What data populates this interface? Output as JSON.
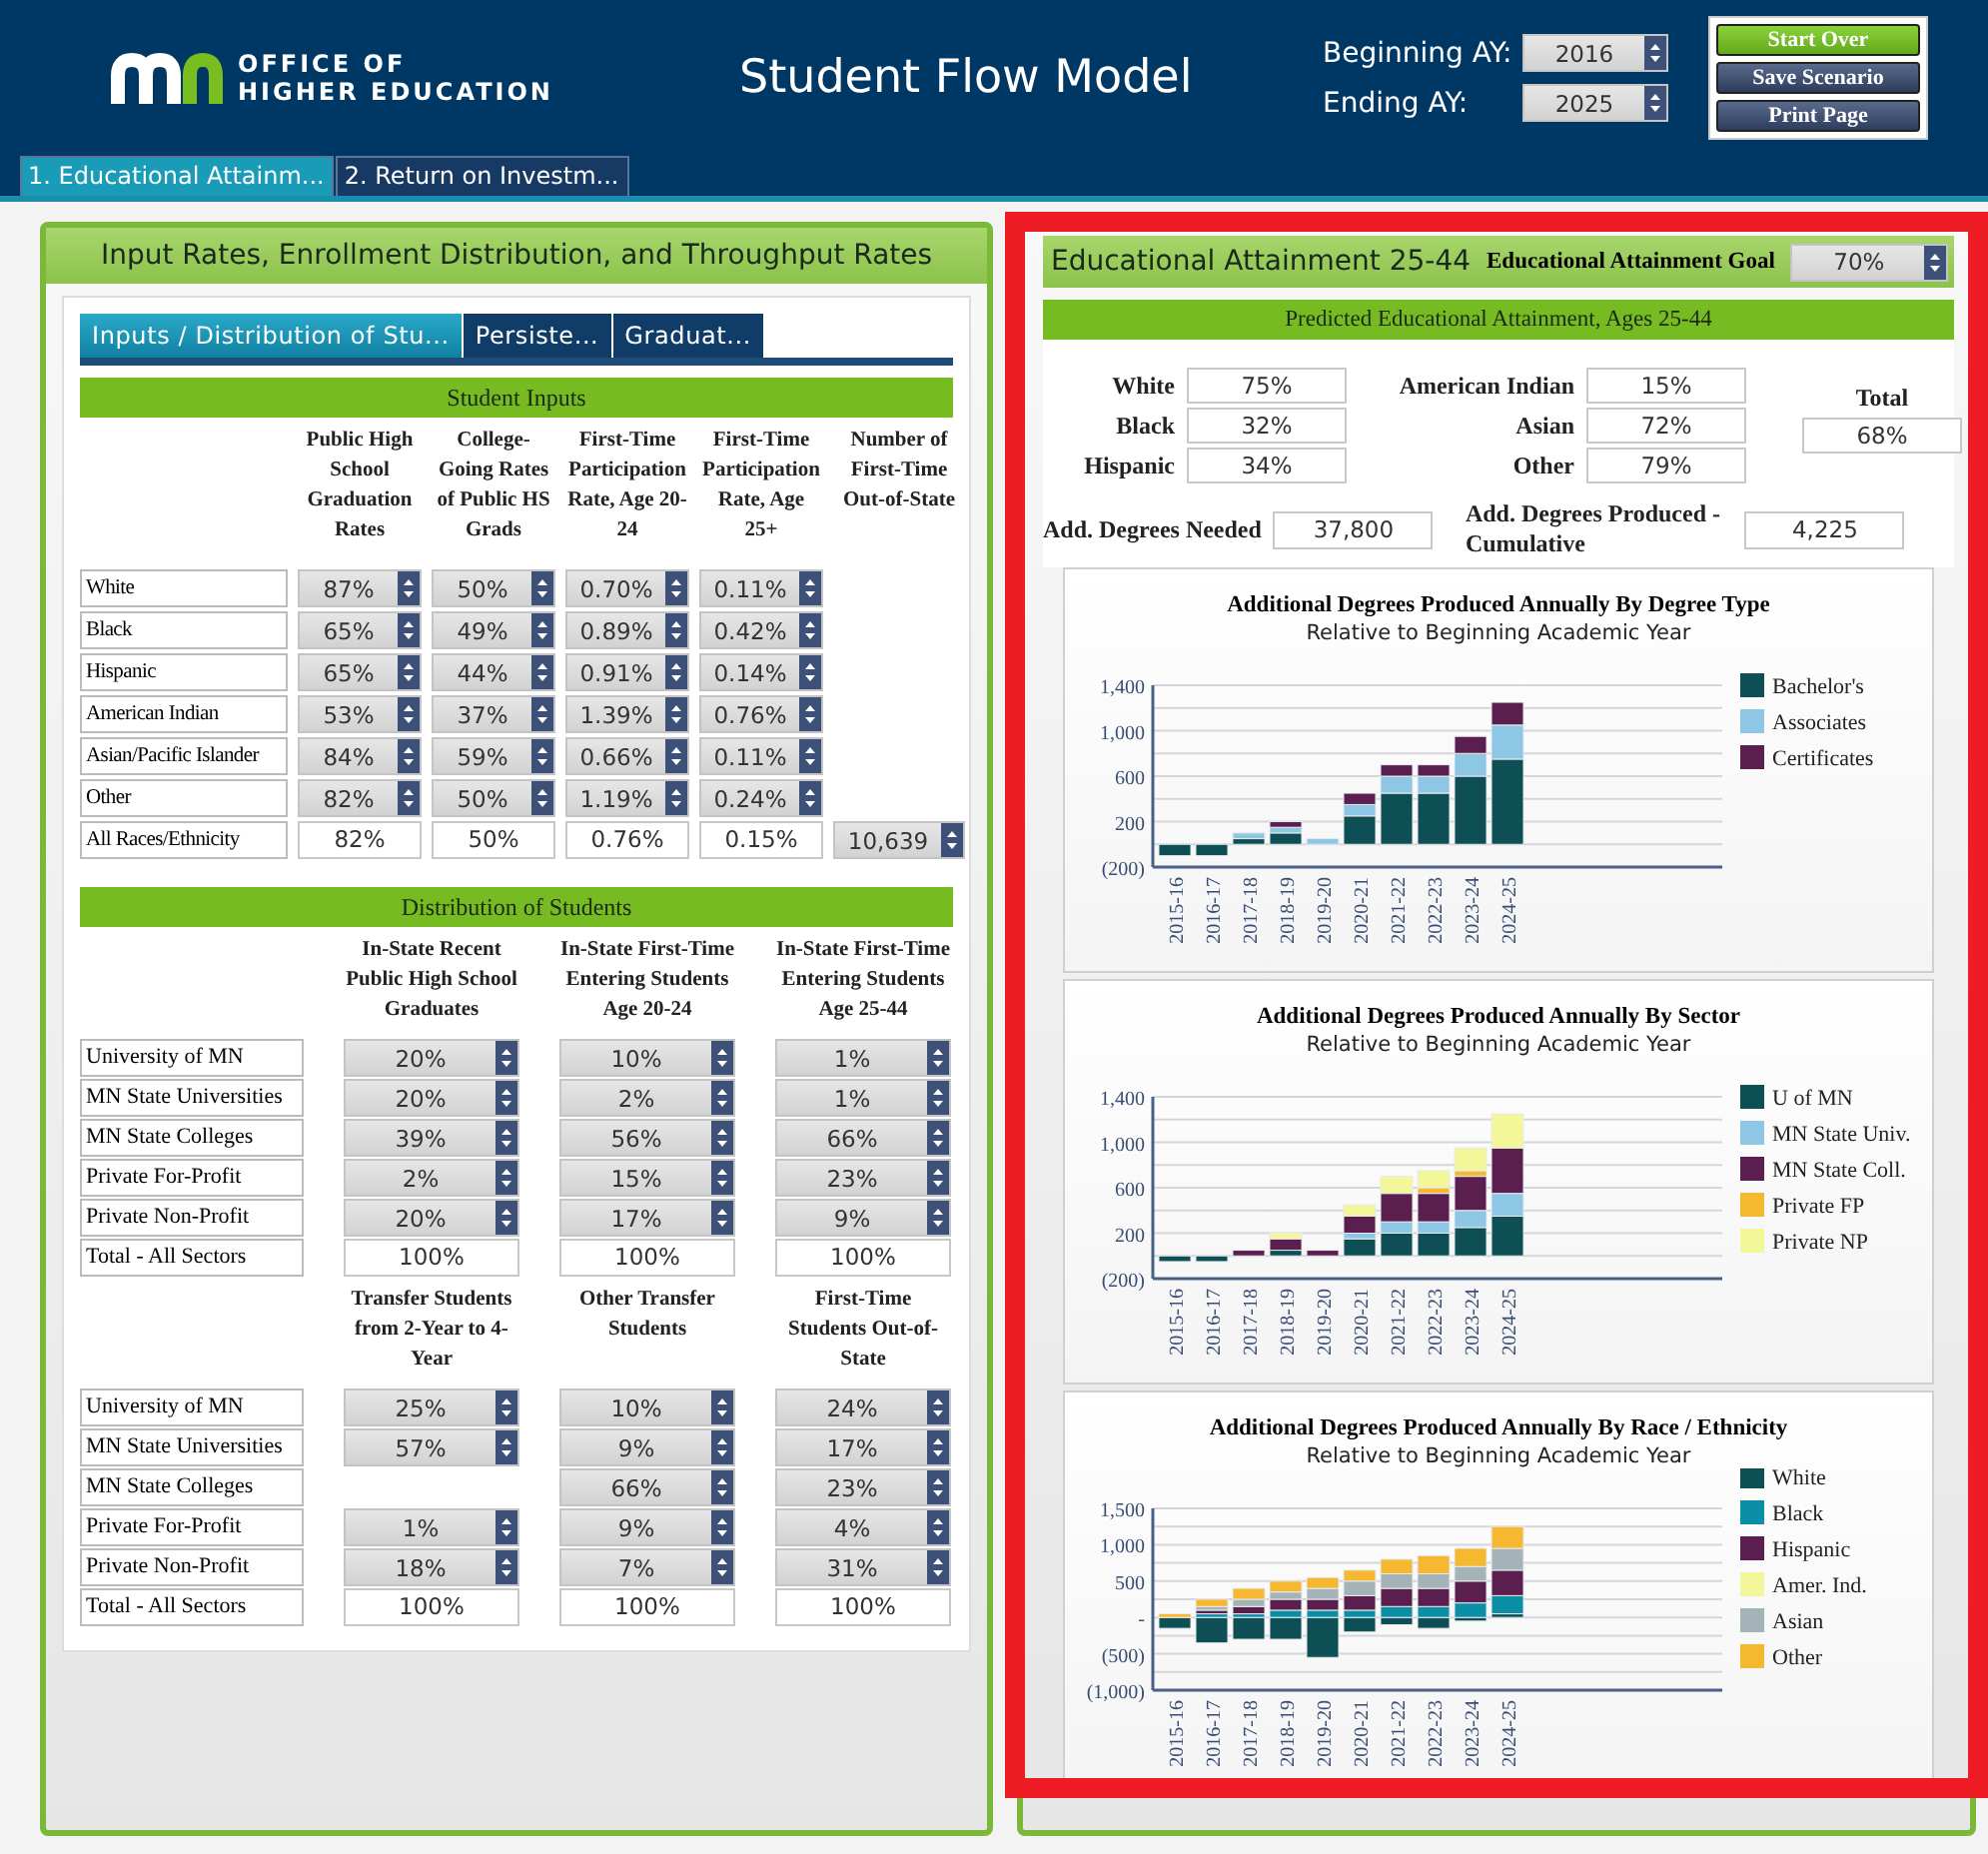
{
  "header": {
    "logo_lines": [
      "OFFICE OF",
      "HIGHER EDUCATION"
    ],
    "title": "Student Flow Model",
    "years": [
      {
        "label": "Beginning AY:",
        "value": "2016"
      },
      {
        "label": "Ending AY:",
        "value": "2025"
      }
    ],
    "buttons": [
      {
        "label": "Start Over",
        "kind": "primary"
      },
      {
        "label": "Save Scenario",
        "kind": "secondary"
      },
      {
        "label": "Print Page",
        "kind": "secondary"
      }
    ]
  },
  "main_tabs": [
    {
      "label": "1. Educational Attainm...",
      "selected": true
    },
    {
      "label": "2. Return on Investm...",
      "selected": false
    }
  ],
  "left_panel": {
    "title": "Input Rates, Enrollment Distribution, and Throughput Rates",
    "tabs": [
      {
        "label": "Inputs / Distribution of Stu...",
        "selected": true
      },
      {
        "label": "Persiste...",
        "selected": false
      },
      {
        "label": "Graduat...",
        "selected": false
      }
    ],
    "student_inputs": {
      "title": "Student Inputs",
      "columns": [
        "Public High School Graduation Rates",
        "College-Going Rates of Public HS Grads",
        "First-Time Participation Rate, Age 20-24",
        "First-Time Participation Rate, Age 25+",
        "Number of First-Time Out-of-State"
      ],
      "rows": [
        {
          "label": "White",
          "values": [
            "87%",
            "50%",
            "0.70%",
            "0.11%"
          ]
        },
        {
          "label": "Black",
          "values": [
            "65%",
            "49%",
            "0.89%",
            "0.42%"
          ]
        },
        {
          "label": "Hispanic",
          "values": [
            "65%",
            "44%",
            "0.91%",
            "0.14%"
          ]
        },
        {
          "label": "American Indian",
          "values": [
            "53%",
            "37%",
            "1.39%",
            "0.76%"
          ]
        },
        {
          "label": "Asian/Pacific Islander",
          "values": [
            "84%",
            "59%",
            "0.66%",
            "0.11%"
          ]
        },
        {
          "label": "Other",
          "values": [
            "82%",
            "50%",
            "1.19%",
            "0.24%"
          ]
        }
      ],
      "total": {
        "label": "All Races/Ethnicity",
        "values": [
          "82%",
          "50%",
          "0.76%",
          "0.15%"
        ],
        "out_of_state": "10,639"
      }
    },
    "distribution": {
      "title": "Distribution of Students",
      "groups": [
        {
          "columns": [
            "In-State Recent Public High School Graduates",
            "In-State First-Time Entering Students Age 20-24",
            "In-State First-Time Entering Students Age 25-44"
          ],
          "rows": [
            {
              "label": "University of MN",
              "values": [
                "20%",
                "10%",
                "1%"
              ]
            },
            {
              "label": "MN State Universities",
              "values": [
                "20%",
                "2%",
                "1%"
              ]
            },
            {
              "label": "MN State Colleges",
              "values": [
                "39%",
                "56%",
                "66%"
              ]
            },
            {
              "label": "Private For-Profit",
              "values": [
                "2%",
                "15%",
                "23%"
              ]
            },
            {
              "label": "Private Non-Profit",
              "values": [
                "20%",
                "17%",
                "9%"
              ]
            }
          ],
          "total": {
            "label": "Total - All Sectors",
            "values": [
              "100%",
              "100%",
              "100%"
            ]
          }
        },
        {
          "columns": [
            "Transfer Students from 2-Year to 4-Year",
            "Other Transfer Students",
            "First-Time Students Out-of-State"
          ],
          "rows": [
            {
              "label": "University of MN",
              "cells": [
                {
                  "kind": "spin",
                  "value": "25%"
                },
                {
                  "kind": "spin",
                  "value": "10%"
                },
                {
                  "kind": "spin",
                  "value": "24%"
                }
              ]
            },
            {
              "label": "MN State Universities",
              "cells": [
                {
                  "kind": "spin",
                  "value": "57%"
                },
                {
                  "kind": "spin",
                  "value": "9%"
                },
                {
                  "kind": "spin",
                  "value": "17%"
                }
              ]
            },
            {
              "label": "MN State Colleges",
              "cells": [
                {
                  "kind": "blank"
                },
                {
                  "kind": "spin",
                  "value": "66%"
                },
                {
                  "kind": "spin",
                  "value": "23%"
                }
              ]
            },
            {
              "label": "Private For-Profit",
              "cells": [
                {
                  "kind": "spin",
                  "value": "1%"
                },
                {
                  "kind": "spin",
                  "value": "9%"
                },
                {
                  "kind": "spin",
                  "value": "4%"
                }
              ]
            },
            {
              "label": "Private Non-Profit",
              "cells": [
                {
                  "kind": "spin",
                  "value": "18%"
                },
                {
                  "kind": "spin",
                  "value": "7%"
                },
                {
                  "kind": "spin",
                  "value": "31%"
                }
              ]
            }
          ],
          "total": {
            "label": "Total - All Sectors",
            "values": [
              "100%",
              "100%",
              "100%"
            ]
          }
        }
      ]
    }
  },
  "right_panel": {
    "title": "Educational Attainment 25-44",
    "goal": {
      "label": "Educational Attainment Goal",
      "value": "70%"
    },
    "subtitle": "Predicted Educational Attainment, Ages 25-44",
    "attainment": [
      {
        "label": "White",
        "value": "75%"
      },
      {
        "label": "Black",
        "value": "32%"
      },
      {
        "label": "Hispanic",
        "value": "34%"
      },
      {
        "label": "American Indian",
        "value": "15%"
      },
      {
        "label": "Asian",
        "value": "72%"
      },
      {
        "label": "Other",
        "value": "79%"
      }
    ],
    "total": {
      "label": "Total",
      "value": "68%"
    },
    "needed": {
      "label": "Add. Degrees Needed",
      "value": "37,800"
    },
    "produced": {
      "label": "Add. Degrees Produced - Cumulative",
      "value": "4,225"
    },
    "charts": [
      {
        "subtitle": "Relative to Beginning Academic Year",
        "chart_data": {
          "type": "bar",
          "title": "Additional Degrees Produced Annually By Degree Type",
          "stacked": true,
          "grid": true,
          "legend": true,
          "categories": [
            "2015-16",
            "2016-17",
            "2017-18",
            "2018-19",
            "2019-20",
            "2020-21",
            "2021-22",
            "2022-23",
            "2023-24",
            "2024-25"
          ],
          "ylim": [
            -200,
            1400
          ],
          "yticks": [
            {
              "value": -200,
              "label": "(200)"
            },
            {
              "value": 200,
              "label": "200"
            },
            {
              "value": 600,
              "label": "600"
            },
            {
              "value": 1000,
              "label": "1,000"
            },
            {
              "value": 1400,
              "label": "1,400"
            }
          ],
          "series": [
            {
              "name": "Bachelor's",
              "color": "#0d4f55",
              "values": [
                -100,
                -100,
                50,
                100,
                0,
                250,
                450,
                450,
                600,
                750
              ]
            },
            {
              "name": "Associates",
              "color": "#8ec6e6",
              "values": [
                0,
                0,
                50,
                50,
                50,
                100,
                150,
                150,
                200,
                300
              ]
            },
            {
              "name": "Certificates",
              "color": "#5a1f4f",
              "values": [
                0,
                0,
                0,
                50,
                0,
                100,
                100,
                100,
                150,
                200
              ]
            }
          ]
        }
      },
      {
        "subtitle": "Relative to Beginning Academic Year",
        "chart_data": {
          "type": "bar",
          "title": "Additional Degrees Produced Annually By Sector",
          "stacked": true,
          "grid": true,
          "legend": true,
          "categories": [
            "2015-16",
            "2016-17",
            "2017-18",
            "2018-19",
            "2019-20",
            "2020-21",
            "2021-22",
            "2022-23",
            "2023-24",
            "2024-25"
          ],
          "ylim": [
            -200,
            1400
          ],
          "yticks": [
            {
              "value": -200,
              "label": "(200)"
            },
            {
              "value": 200,
              "label": "200"
            },
            {
              "value": 600,
              "label": "600"
            },
            {
              "value": 1000,
              "label": "1,000"
            },
            {
              "value": 1400,
              "label": "1,400"
            }
          ],
          "series": [
            {
              "name": "U of MN",
              "color": "#0d4f55",
              "values": [
                -50,
                -50,
                0,
                50,
                0,
                150,
                200,
                200,
                250,
                350
              ]
            },
            {
              "name": "MN State Univ.",
              "color": "#8ec6e6",
              "values": [
                0,
                0,
                0,
                0,
                0,
                50,
                100,
                100,
                150,
                200
              ]
            },
            {
              "name": "MN State Coll.",
              "color": "#5a1f4f",
              "values": [
                0,
                0,
                50,
                100,
                50,
                150,
                250,
                250,
                300,
                400
              ]
            },
            {
              "name": "Private FP",
              "color": "#f5b830",
              "values": [
                0,
                0,
                0,
                0,
                0,
                0,
                0,
                50,
                50,
                0
              ]
            },
            {
              "name": "Private NP",
              "color": "#f3f79a",
              "values": [
                0,
                0,
                0,
                50,
                0,
                100,
                150,
                150,
                200,
                300
              ]
            }
          ]
        }
      },
      {
        "subtitle": "Relative to Beginning Academic Year",
        "chart_data": {
          "type": "bar",
          "title": "Additional Degrees Produced Annually By Race / Ethnicity",
          "stacked": true,
          "grid": true,
          "legend": true,
          "categories": [
            "2015-16",
            "2016-17",
            "2017-18",
            "2018-19",
            "2019-20",
            "2020-21",
            "2021-22",
            "2022-23",
            "2023-24",
            "2024-25"
          ],
          "ylim": [
            -1000,
            1500
          ],
          "yticks": [
            {
              "value": -1000,
              "label": "(1,000)"
            },
            {
              "value": -500,
              "label": "(500)"
            },
            {
              "value": 0,
              "label": "-"
            },
            {
              "value": 500,
              "label": "500"
            },
            {
              "value": 1000,
              "label": "1,000"
            },
            {
              "value": 1500,
              "label": "1,500"
            }
          ],
          "series": [
            {
              "name": "White",
              "color": "#0d4f55",
              "values": [
                -150,
                -350,
                -300,
                -300,
                -550,
                -200,
                -100,
                -150,
                -50,
                50
              ]
            },
            {
              "name": "Black",
              "color": "#0b8fa6",
              "values": [
                0,
                50,
                50,
                100,
                100,
                100,
                150,
                150,
                200,
                250
              ]
            },
            {
              "name": "Hispanic",
              "color": "#5a1f4f",
              "values": [
                0,
                50,
                100,
                150,
                150,
                200,
                250,
                250,
                300,
                350
              ]
            },
            {
              "name": "Amer. Ind.",
              "color": "#f3f79a",
              "values": [
                0,
                0,
                0,
                0,
                0,
                0,
                0,
                0,
                0,
                0
              ]
            },
            {
              "name": "Asian",
              "color": "#a3b3b8",
              "values": [
                0,
                50,
                100,
                100,
                150,
                200,
                200,
                200,
                200,
                300
              ]
            },
            {
              "name": "Other",
              "color": "#f5b830",
              "values": [
                50,
                100,
                150,
                150,
                150,
                150,
                200,
                250,
                250,
                300
              ]
            }
          ]
        }
      }
    ]
  }
}
